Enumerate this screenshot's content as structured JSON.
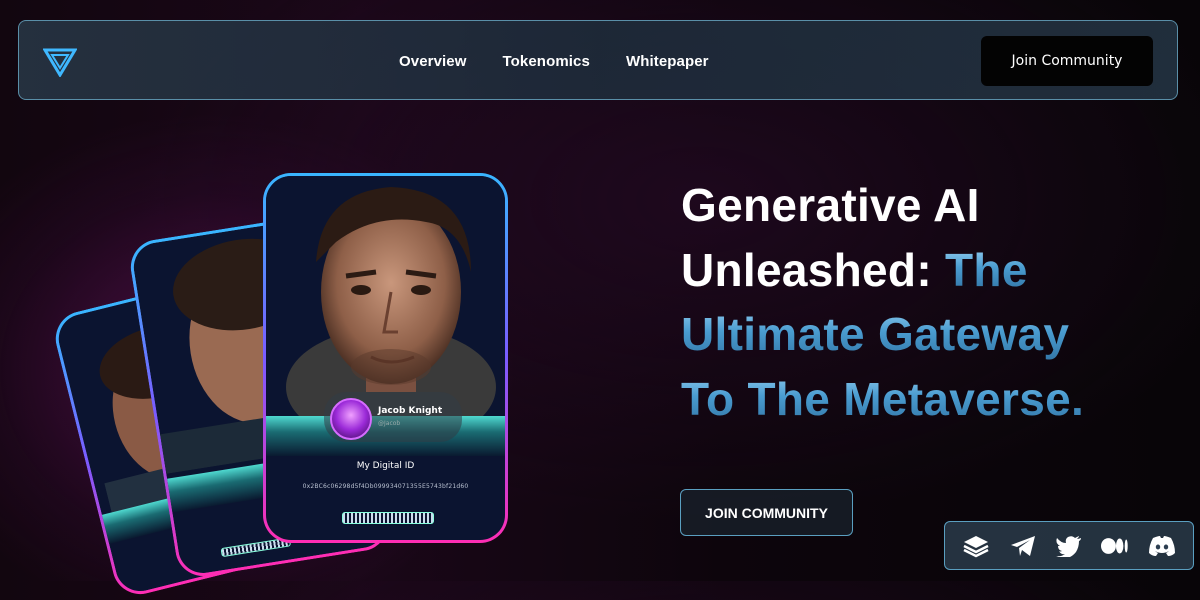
{
  "nav": {
    "logo_icon": "v-triangle-logo-icon",
    "links": [
      "Overview",
      "Tokenomics",
      "Whitepaper"
    ],
    "join_label": "Join Community"
  },
  "hero": {
    "line1": "Generative AI",
    "line2_white": "Unleashed: ",
    "line2_blue": "The",
    "line3": "Ultimate Gateway",
    "line4": "To The Metaverse.",
    "cta_label": "JOIN COMMUNITY"
  },
  "card": {
    "name": "Jacob Knight",
    "handle": "@Jacob",
    "label": "My Digital ID",
    "address": "0x2BC6c06298d5f4Db099934071355E5743bf21d60"
  },
  "social": {
    "icons": [
      "gitbook-icon",
      "telegram-icon",
      "twitter-icon",
      "medium-icon",
      "discord-icon"
    ]
  },
  "colors": {
    "accent_blue": "#5fa8d6",
    "border_cyan": "#5a9fc0",
    "card_gradient_top": "#39b6ff",
    "card_gradient_bottom": "#ff2db4"
  }
}
